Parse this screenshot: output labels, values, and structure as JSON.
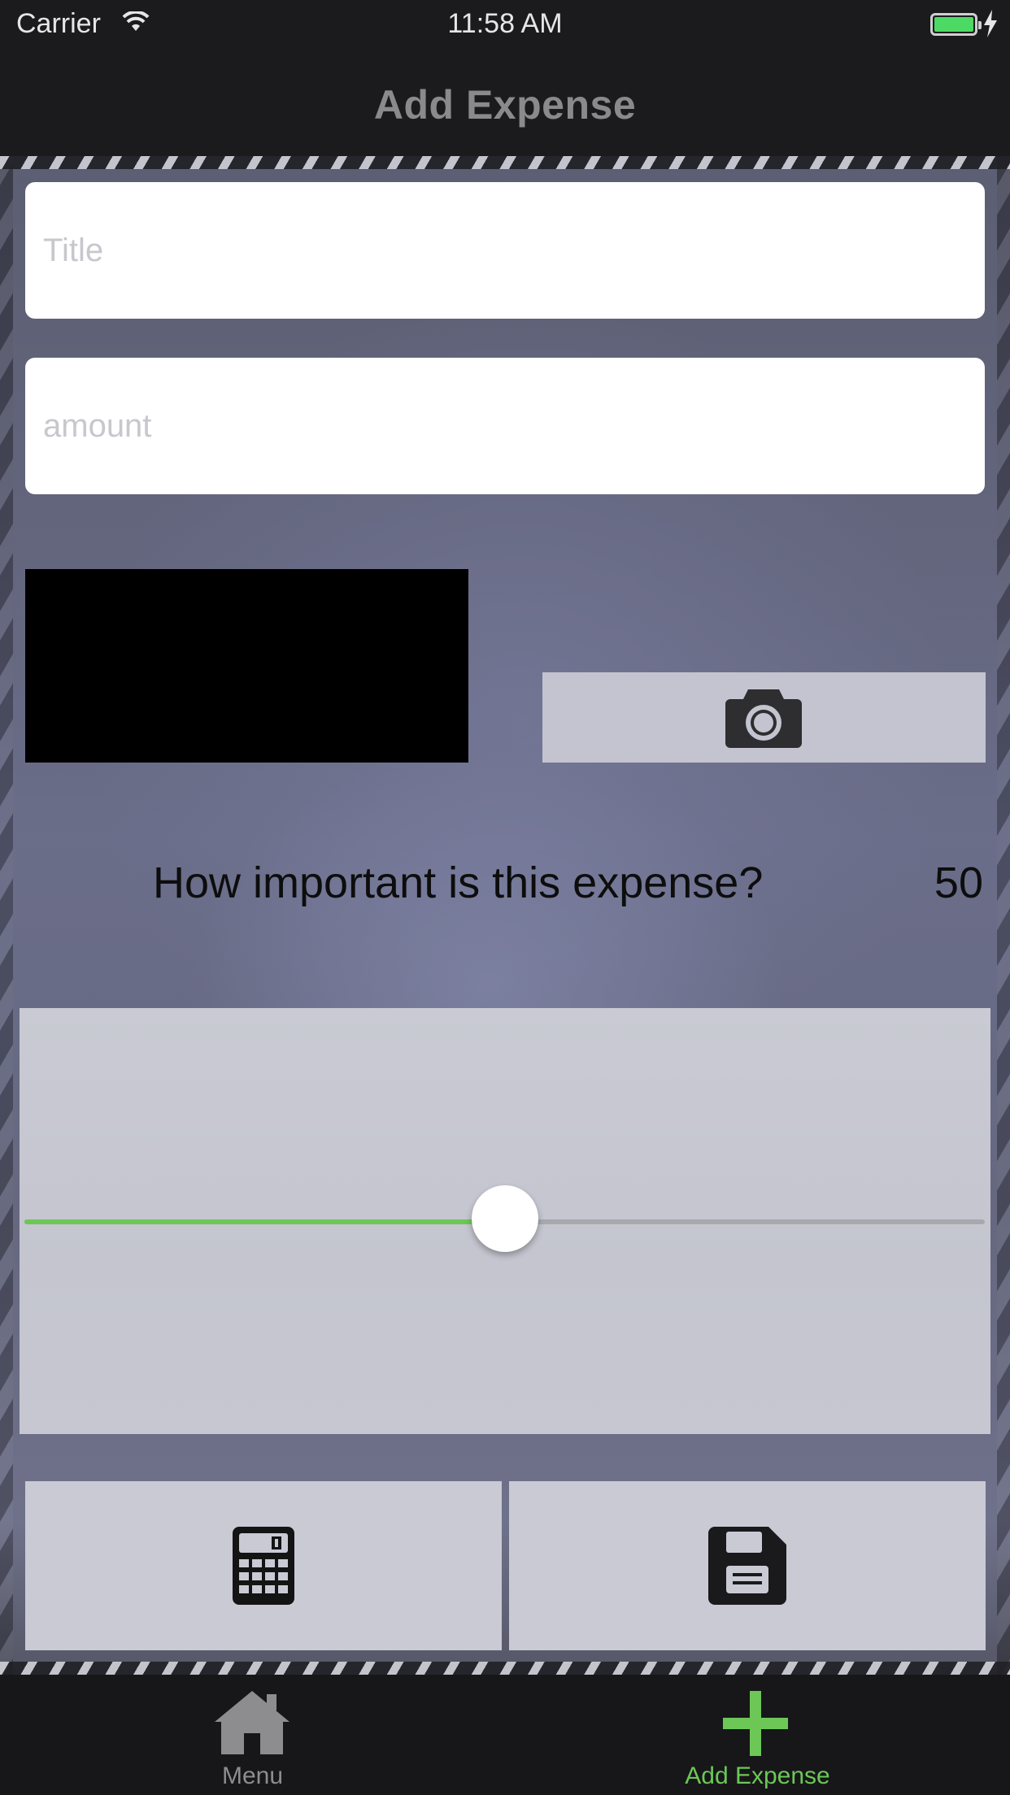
{
  "status_bar": {
    "carrier": "Carrier",
    "time": "11:58 AM",
    "battery_color": "#4cd964"
  },
  "nav": {
    "title": "Add Expense"
  },
  "form": {
    "title_placeholder": "Title",
    "amount_placeholder": "amount",
    "question": "How important is this expense?",
    "importance_value": "50",
    "slider_fraction": 0.5
  },
  "icons": {
    "camera": "camera-icon",
    "calculator": "calculator-icon",
    "save": "save-icon"
  },
  "tabs": [
    {
      "label": "Menu",
      "icon": "home-icon",
      "selected": false
    },
    {
      "label": "Add Expense",
      "icon": "plus-icon",
      "selected": true
    }
  ],
  "colors": {
    "accent": "#6cc757",
    "tab_inactive": "#8d8d90"
  }
}
